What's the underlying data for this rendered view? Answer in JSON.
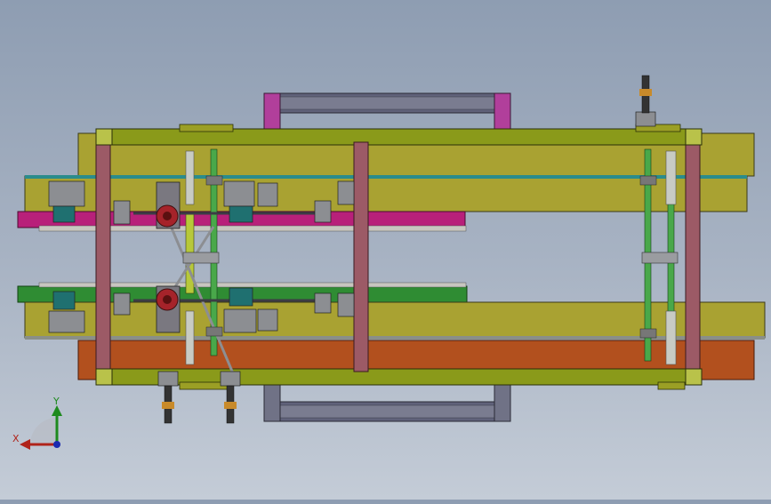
{
  "view": {
    "background_top": "#8e9db2",
    "background_bottom": "#c4ccd7"
  },
  "palette": {
    "frame_green": "#8a9a1a",
    "frame_olive": "#9b9f25",
    "post_maroon": "#9c5a66",
    "belt_magenta": "#b8207a",
    "belt_green": "#2f8c33",
    "belt_orange": "#b2501e",
    "belt_yellow": "#a9a232",
    "rail_teal": "#2a8c8c",
    "top_tray": "#6e7082",
    "top_tray_end": "#b13f9b",
    "gearbox_red": "#a5232a",
    "shaft_green": "#49a84a",
    "shaft_yellow": "#b7c83a"
  },
  "triad": {
    "x_label": "X",
    "y_label": "Y",
    "x_icon": "x-axis-arrow-icon",
    "y_icon": "y-axis-arrow-icon",
    "z_icon": "z-axis-dot-icon"
  }
}
